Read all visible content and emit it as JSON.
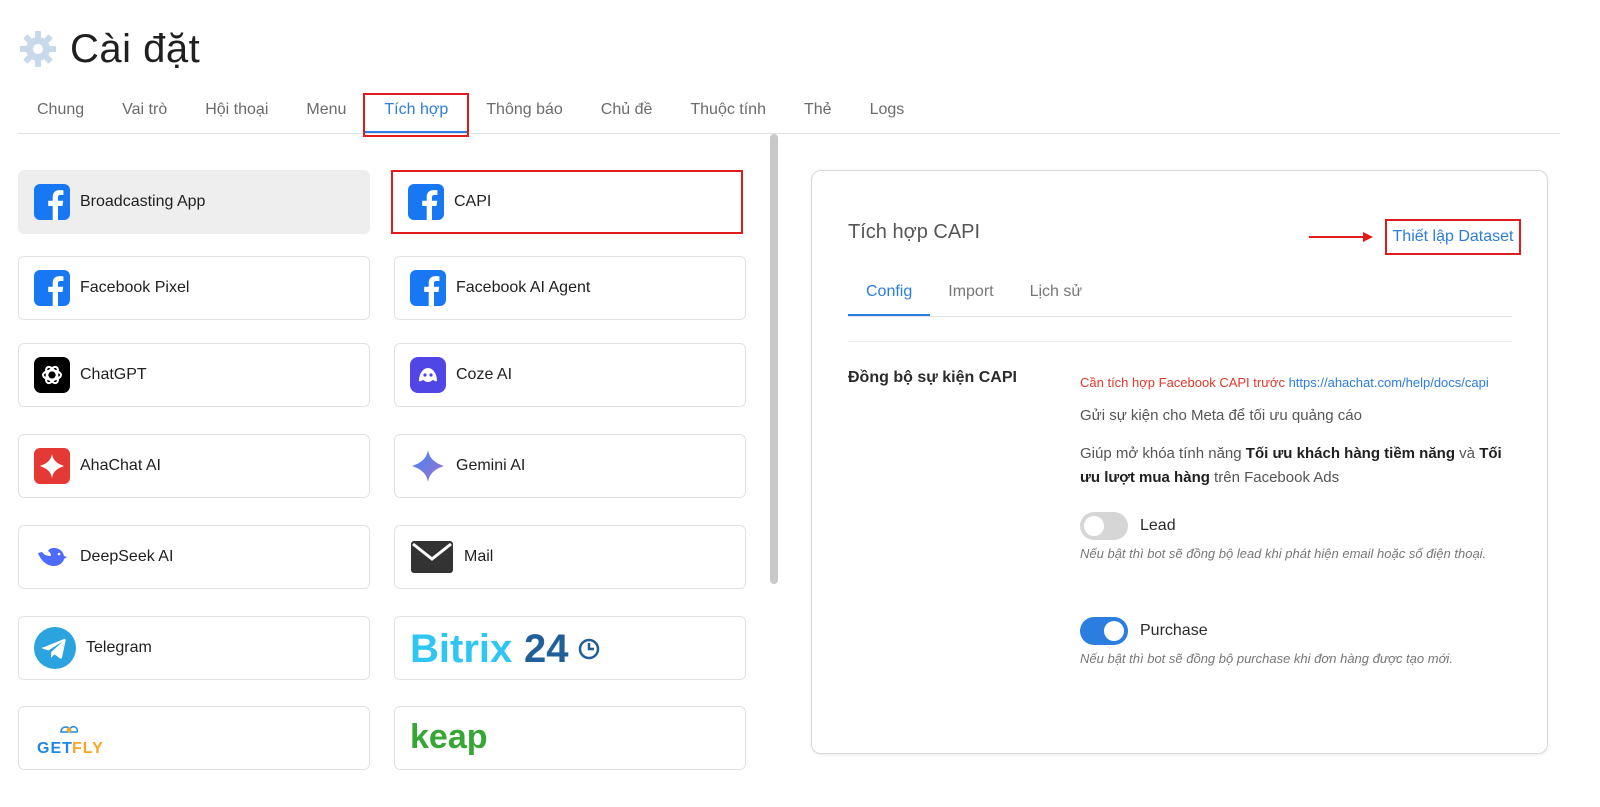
{
  "header": {
    "title": "Cài đặt"
  },
  "tabs": [
    {
      "label": "Chung"
    },
    {
      "label": "Vai trò"
    },
    {
      "label": "Hội thoại"
    },
    {
      "label": "Menu"
    },
    {
      "label": "Tích hợp"
    },
    {
      "label": "Thông báo"
    },
    {
      "label": "Chủ đề"
    },
    {
      "label": "Thuộc tính"
    },
    {
      "label": "Thẻ"
    },
    {
      "label": "Logs"
    }
  ],
  "apps": [
    {
      "label": "Broadcasting App",
      "icon": "facebook-icon"
    },
    {
      "label": "CAPI",
      "icon": "facebook-icon"
    },
    {
      "label": "Facebook Pixel",
      "icon": "facebook-icon"
    },
    {
      "label": "Facebook AI Agent",
      "icon": "facebook-icon"
    },
    {
      "label": "ChatGPT",
      "icon": "chatgpt-icon"
    },
    {
      "label": "Coze AI",
      "icon": "coze-icon"
    },
    {
      "label": "AhaChat AI",
      "icon": "ahachat-icon"
    },
    {
      "label": "Gemini AI",
      "icon": "gemini-icon"
    },
    {
      "label": "DeepSeek AI",
      "icon": "deepseek-icon"
    },
    {
      "label": "Mail",
      "icon": "mail-icon"
    },
    {
      "label": "Telegram",
      "icon": "telegram-icon"
    },
    {
      "label": "Bitrix24",
      "icon": "bitrix24-logo"
    },
    {
      "label": "GETFLY",
      "icon": "getfly-logo"
    },
    {
      "label": "keap",
      "icon": "keap-logo"
    }
  ],
  "panel": {
    "title": "Tích hợp CAPI",
    "setup_link": "Thiết lập Dataset",
    "subtabs": [
      {
        "label": "Config"
      },
      {
        "label": "Import"
      },
      {
        "label": "Lịch sử"
      }
    ],
    "section_label": "Đồng bộ sự kiện CAPI",
    "warning_text": "Cần tích hợp Facebook CAPI trước",
    "warning_link": "https://ahachat.com/help/docs/capi",
    "desc1": "Gửi sự kiện cho Meta để tối ưu quảng cáo",
    "desc2_a": "Giúp mở khóa tính năng ",
    "desc2_b": "Tối ưu khách hàng tiềm năng",
    "desc2_c": " và ",
    "desc2_d": "Tối ưu lượt mua hàng",
    "desc2_e": " trên Facebook Ads",
    "toggles": [
      {
        "label": "Lead",
        "on": false,
        "hint": "Nếu bật thì bot sẽ đồng bộ lead khi phát hiện email hoặc số điện thoại."
      },
      {
        "label": "Purchase",
        "on": true,
        "hint": "Nếu bật thì bot sẽ đồng bộ purchase khi đơn hàng được tạo mới."
      }
    ]
  },
  "colors": {
    "accent": "#2b7de0",
    "highlight": "#e01b1b",
    "facebook": "#1877f2"
  }
}
